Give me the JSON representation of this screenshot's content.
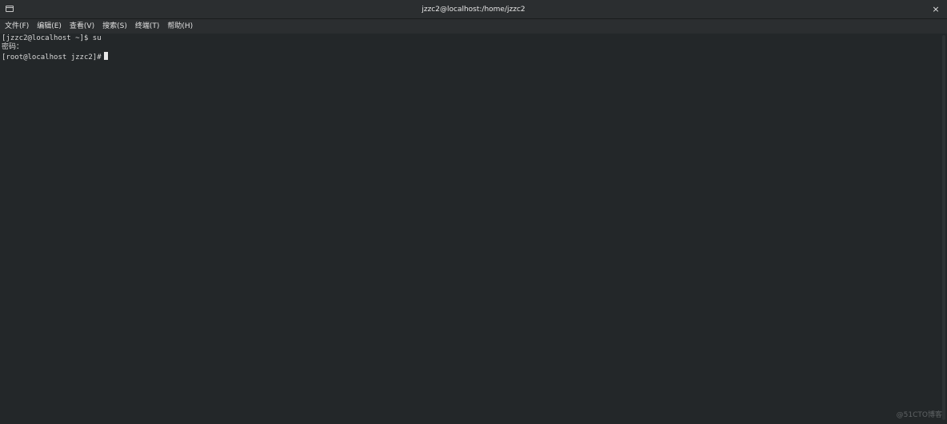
{
  "window": {
    "title": "jzzc2@localhost:/home/jzzc2",
    "close_glyph": "×",
    "icon": "terminal-icon"
  },
  "menubar": {
    "items": [
      {
        "label": "文件(F)"
      },
      {
        "label": "编辑(E)"
      },
      {
        "label": "查看(V)"
      },
      {
        "label": "搜索(S)"
      },
      {
        "label": "终端(T)"
      },
      {
        "label": "帮助(H)"
      }
    ]
  },
  "terminal": {
    "lines": [
      "[jzzc2@localhost ~]$ su",
      "密码：",
      "[root@localhost jzzc2]#"
    ]
  },
  "watermark": "@51CTO博客",
  "colors": {
    "background": "#232729",
    "titlebar": "#2b2e30",
    "text": "#d8d8d8"
  }
}
